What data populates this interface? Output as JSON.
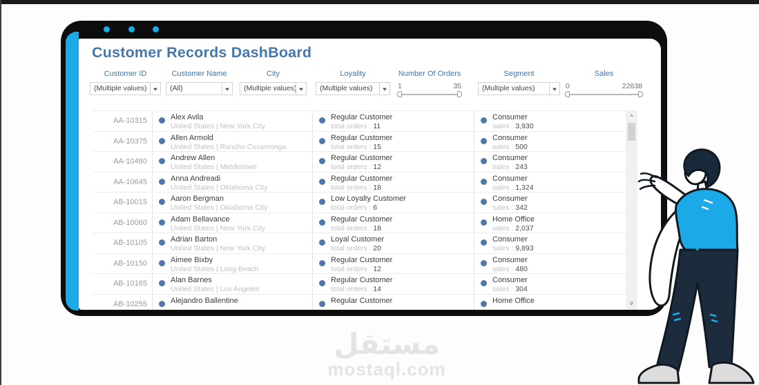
{
  "header": {
    "title": "Customer Records DashBoard"
  },
  "filters": [
    {
      "label": "Customer ID",
      "type": "dropdown",
      "value": "(Multiple values)"
    },
    {
      "label": "Customer Name",
      "type": "dropdown",
      "value": "(All)"
    },
    {
      "label": "City",
      "type": "dropdown",
      "value": "(Multiple values)"
    },
    {
      "label": "Loyality",
      "type": "dropdown",
      "value": "(Multiple values)"
    },
    {
      "label": "Number Of Orders",
      "type": "range",
      "min": "1",
      "max": "35"
    },
    {
      "label": "Segment",
      "type": "dropdown",
      "value": "(Multiple values)"
    },
    {
      "label": "Sales",
      "type": "range",
      "min": "0",
      "max": "22638"
    }
  ],
  "table": {
    "rows": [
      {
        "id": "AA-10315",
        "name": "Alex Avila",
        "location": "United States | New York City",
        "loyalty": "Regular Customer",
        "orders_label": "total orders :",
        "orders_value": "11",
        "segment": "Consumer",
        "sales_label": "sales :",
        "sales_value": "3,930"
      },
      {
        "id": "AA-10375",
        "name": "Allen Armold",
        "location": "United States | Rancho Cucamonga",
        "loyalty": "Regular Customer",
        "orders_label": "total orders :",
        "orders_value": "15",
        "segment": "Consumer",
        "sales_label": "sales :",
        "sales_value": "500"
      },
      {
        "id": "AA-10480",
        "name": "Andrew Allen",
        "location": "United States | Middletown",
        "loyalty": "Regular Customer",
        "orders_label": "total orders :",
        "orders_value": "12",
        "segment": "Consumer",
        "sales_label": "sales :",
        "sales_value": "243"
      },
      {
        "id": "AA-10645",
        "name": "Anna Andreadi",
        "location": "United States | Oklahoma City",
        "loyalty": "Regular Customer",
        "orders_label": "total orders :",
        "orders_value": "18",
        "segment": "Consumer",
        "sales_label": "sales :",
        "sales_value": "1,324"
      },
      {
        "id": "AB-10015",
        "name": "Aaron Bergman",
        "location": "United States | Oklahoma City",
        "loyalty": "Low Loyalty Customer",
        "orders_label": "total orders :",
        "orders_value": "6",
        "segment": "Consumer",
        "sales_label": "sales :",
        "sales_value": "342"
      },
      {
        "id": "AB-10060",
        "name": "Adam Bellavance",
        "location": "United States | New York City",
        "loyalty": "Regular Customer",
        "orders_label": "total orders :",
        "orders_value": "18",
        "segment": "Home Office",
        "sales_label": "sales :",
        "sales_value": "2,037"
      },
      {
        "id": "AB-10105",
        "name": "Adrian Barton",
        "location": "United States | New York City",
        "loyalty": "Loyal Customer",
        "orders_label": "total orders :",
        "orders_value": "20",
        "segment": "Consumer",
        "sales_label": "sales :",
        "sales_value": "9,893"
      },
      {
        "id": "AB-10150",
        "name": "Aimee Bixby",
        "location": "United States | Long Beach",
        "loyalty": "Regular Customer",
        "orders_label": "total orders :",
        "orders_value": "12",
        "segment": "Consumer",
        "sales_label": "sales :",
        "sales_value": "480"
      },
      {
        "id": "AB-10165",
        "name": "Alan Barnes",
        "location": "United States | Los Angeles",
        "loyalty": "Regular Customer",
        "orders_label": "total orders :",
        "orders_value": "14",
        "segment": "Consumer",
        "sales_label": "sales :",
        "sales_value": "304"
      },
      {
        "id": "AB-10255",
        "name": "Alejandro Ballentine",
        "location": null,
        "loyalty": "Regular Customer",
        "orders_label": null,
        "orders_value": null,
        "segment": "Home Office",
        "sales_label": null,
        "sales_value": null
      }
    ]
  },
  "icons": {
    "chevron_up": "^",
    "chevron_down": "v",
    "dropdown_arrow": "▾"
  },
  "watermark": {
    "arabic": "مستقل",
    "domain": "mostaql.com"
  },
  "colors": {
    "accent_blue": "#1BA9E8",
    "title_blue": "#4577AD",
    "label_blue": "#3A78B2",
    "mark_blue": "#4E79A7",
    "frame_black": "#0D0D0D",
    "pants_navy": "#1D2C3C",
    "watermark_gray": "#E4E4E4"
  }
}
